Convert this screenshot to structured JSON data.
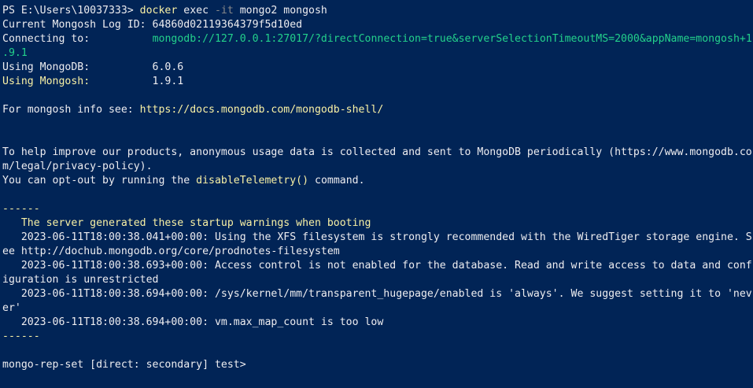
{
  "colors": {
    "background": "#012456",
    "text": "#eeedf0",
    "yellow": "#f9f1a5",
    "green": "#23d18b",
    "gray": "#8a8a8a"
  },
  "lines": [
    {
      "segments": [
        {
          "text": "PS E:\\Users\\10037333> ",
          "color": "#eeedf0"
        },
        {
          "text": "docker",
          "color": "#f9f1a5"
        },
        {
          "text": " exec ",
          "color": "#eeedf0"
        },
        {
          "text": "-it",
          "color": "#8a8a8a"
        },
        {
          "text": " mongo2 mongosh",
          "color": "#eeedf0"
        }
      ]
    },
    {
      "segments": [
        {
          "text": "Current Mongosh Log ID: 64860d02119364379f5d10ed",
          "color": "#eeedf0"
        }
      ]
    },
    {
      "segments": [
        {
          "text": "Connecting to:          ",
          "color": "#eeedf0"
        },
        {
          "text": "mongodb://127.0.0.1:27017/?directConnection=true&serverSelectionTimeoutMS=2000&appName=mongosh+1",
          "color": "#23d18b"
        }
      ]
    },
    {
      "segments": [
        {
          "text": ".9.1",
          "color": "#23d18b"
        }
      ]
    },
    {
      "segments": [
        {
          "text": "Using MongoDB:          6.0.6",
          "color": "#eeedf0"
        }
      ]
    },
    {
      "segments": [
        {
          "text": "Using Mongosh:",
          "color": "#f9f1a5"
        },
        {
          "text": "          1.9.1",
          "color": "#eeedf0"
        }
      ]
    },
    {
      "segments": [
        {
          "text": "",
          "color": "#eeedf0"
        }
      ]
    },
    {
      "segments": [
        {
          "text": "For mongosh info see: ",
          "color": "#eeedf0"
        },
        {
          "text": "https://docs.mongodb.com/mongodb-shell/",
          "color": "#f9f1a5"
        }
      ]
    },
    {
      "segments": [
        {
          "text": "",
          "color": "#eeedf0"
        }
      ]
    },
    {
      "segments": [
        {
          "text": "",
          "color": "#eeedf0"
        }
      ]
    },
    {
      "segments": [
        {
          "text": "To help improve our products, anonymous usage data is collected and sent to MongoDB periodically (https://www.mongodb.co",
          "color": "#eeedf0"
        }
      ]
    },
    {
      "segments": [
        {
          "text": "m/legal/privacy-policy).",
          "color": "#eeedf0"
        }
      ]
    },
    {
      "segments": [
        {
          "text": "You can opt-out by running the ",
          "color": "#eeedf0"
        },
        {
          "text": "disableTelemetry()",
          "color": "#f9f1a5"
        },
        {
          "text": " command.",
          "color": "#eeedf0"
        }
      ]
    },
    {
      "segments": [
        {
          "text": "",
          "color": "#eeedf0"
        }
      ]
    },
    {
      "segments": [
        {
          "text": "------",
          "color": "#f9f1a5"
        }
      ]
    },
    {
      "segments": [
        {
          "text": "   The server generated these startup warnings when booting",
          "color": "#f9f1a5"
        }
      ]
    },
    {
      "segments": [
        {
          "text": "   2023-06-11T18:00:38.041+00:00: Using the XFS filesystem is strongly recommended with the WiredTiger storage engine. S",
          "color": "#eeedf0"
        }
      ]
    },
    {
      "segments": [
        {
          "text": "ee http://dochub.mongodb.org/core/prodnotes-filesystem",
          "color": "#eeedf0"
        }
      ]
    },
    {
      "segments": [
        {
          "text": "   2023-06-11T18:00:38.693+00:00: Access control is not enabled for the database. Read and write access to data and conf",
          "color": "#eeedf0"
        }
      ]
    },
    {
      "segments": [
        {
          "text": "iguration is unrestricted",
          "color": "#eeedf0"
        }
      ]
    },
    {
      "segments": [
        {
          "text": "   2023-06-11T18:00:38.694+00:00: /sys/kernel/mm/transparent_hugepage/enabled is 'always'. We suggest setting it to 'nev",
          "color": "#eeedf0"
        }
      ]
    },
    {
      "segments": [
        {
          "text": "er'",
          "color": "#eeedf0"
        }
      ]
    },
    {
      "segments": [
        {
          "text": "   2023-06-11T18:00:38.694+00:00: vm.max_map_count is too low",
          "color": "#eeedf0"
        }
      ]
    },
    {
      "segments": [
        {
          "text": "------",
          "color": "#f9f1a5"
        }
      ]
    },
    {
      "segments": [
        {
          "text": "",
          "color": "#eeedf0"
        }
      ]
    },
    {
      "segments": [
        {
          "text": "mongo-rep-set [direct: secondary] test> ",
          "color": "#eeedf0"
        }
      ]
    }
  ]
}
